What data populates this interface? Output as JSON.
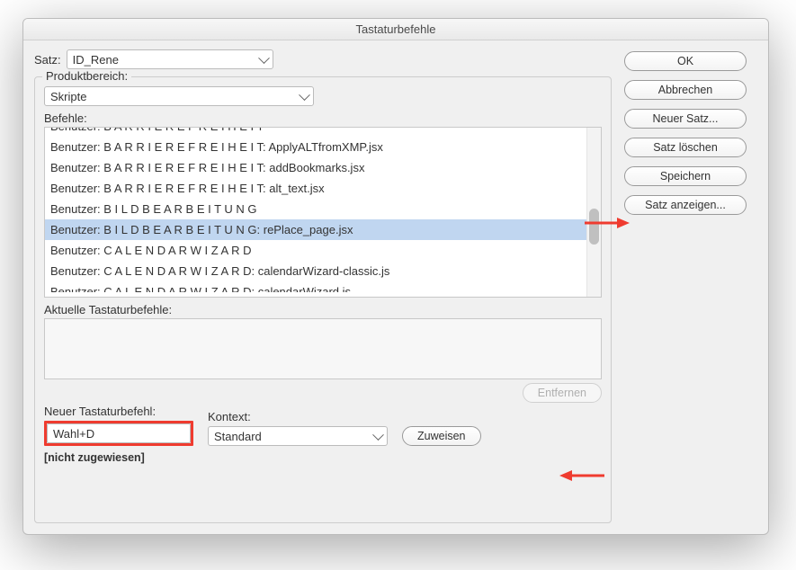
{
  "title": "Tastaturbefehle",
  "satz": {
    "label": "Satz:",
    "value": "ID_Rene"
  },
  "produktbereich": {
    "label": "Produktbereich:",
    "value": "Skripte"
  },
  "befehle_label": "Befehle:",
  "commands": [
    "Benutzer: B A R R I E R E F R E I H E I T",
    "Benutzer: B A R R I E R E F R E I H E I T: ApplyALTfromXMP.jsx",
    "Benutzer: B A R R I E R E F R E I H E I T: addBookmarks.jsx",
    "Benutzer: B A R R I E R E F R E I H E I T: alt_text.jsx",
    "Benutzer: B I L D B E A R B E I T U N G",
    "Benutzer: B I L D B E A R B E I T U N G: rePlace_page.jsx",
    "Benutzer: C A L E N D A R   W I Z A R D",
    "Benutzer: C A L E N D A R   W I Z A R D: calendarWizard-classic.js",
    "Benutzer: C A L E N D A R   W I Z A R D: calendarWizard.js"
  ],
  "selected_index": 5,
  "current_label": "Aktuelle Tastaturbefehle:",
  "remove_btn": "Entfernen",
  "new_shortcut_label": "Neuer Tastaturbefehl:",
  "new_shortcut_value": "Wahl+D",
  "context_label": "Kontext:",
  "context_value": "Standard",
  "assign_btn": "Zuweisen",
  "status": "[nicht zugewiesen]",
  "buttons": {
    "ok": "OK",
    "cancel": "Abbrechen",
    "new_set": "Neuer Satz...",
    "delete_set": "Satz löschen",
    "save": "Speichern",
    "show_set": "Satz anzeigen..."
  }
}
